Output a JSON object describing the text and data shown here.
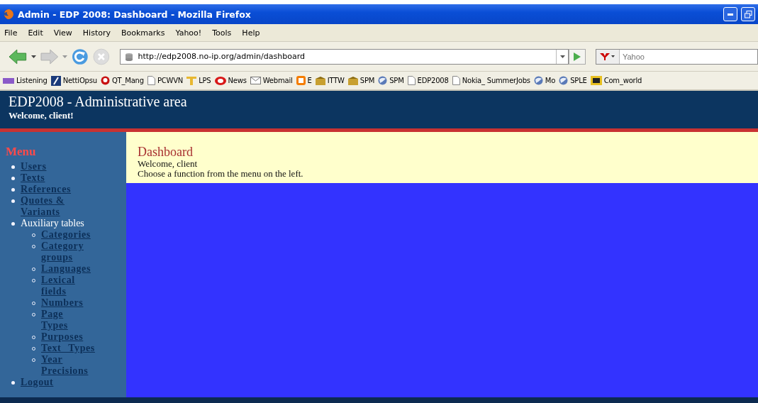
{
  "window": {
    "title": "Admin - EDP 2008: Dashboard - Mozilla Firefox"
  },
  "menu_bar": [
    "File",
    "Edit",
    "View",
    "History",
    "Bookmarks",
    "Yahoo!",
    "Tools",
    "Help"
  ],
  "address_bar": {
    "value": "http://edp2008.no-ip.org/admin/dashboard"
  },
  "search": {
    "placeholder": "Yahoo"
  },
  "bookmarks": [
    {
      "label": "Listening"
    },
    {
      "label": "NettiOpsu"
    },
    {
      "label": "QT_Mang"
    },
    {
      "label": "PCWVN"
    },
    {
      "label": "LPS"
    },
    {
      "label": "News"
    },
    {
      "label": "Webmail"
    },
    {
      "label": "E"
    },
    {
      "label": "ITTW"
    },
    {
      "label": "SPM"
    },
    {
      "label": "SPM"
    },
    {
      "label": "EDP2008"
    },
    {
      "label": "Nokia_ SummerJobs"
    },
    {
      "label": "Mo"
    },
    {
      "label": "SPLE"
    },
    {
      "label": "Com_world"
    }
  ],
  "site_header": {
    "title": "EDP2008 - Administrative area",
    "subtitle": "Welcome, client!"
  },
  "sidebar": {
    "heading": "Menu",
    "items": [
      {
        "label": "Users",
        "kind": "link"
      },
      {
        "label": "Texts",
        "kind": "link"
      },
      {
        "label": "References",
        "kind": "link"
      },
      {
        "label": "Quotes & Variants",
        "kind": "link"
      },
      {
        "label": "Auxiliary tables",
        "kind": "label",
        "children": [
          {
            "label": "Categories",
            "kind": "link"
          },
          {
            "label": "Category groups",
            "kind": "link"
          },
          {
            "label": "Languages",
            "kind": "link"
          },
          {
            "label": "Lexical fields",
            "kind": "link"
          },
          {
            "label": "Numbers",
            "kind": "link"
          },
          {
            "label": "Page Types",
            "kind": "link"
          },
          {
            "label": "Purposes",
            "kind": "link"
          },
          {
            "label": "Text Types",
            "kind": "link"
          },
          {
            "label": "Year Precisions",
            "kind": "link"
          }
        ]
      },
      {
        "label": "Logout",
        "kind": "link"
      }
    ]
  },
  "content": {
    "heading": "Dashboard",
    "lines": [
      "Welcome, client",
      "Choose a function from the menu on the left."
    ]
  }
}
